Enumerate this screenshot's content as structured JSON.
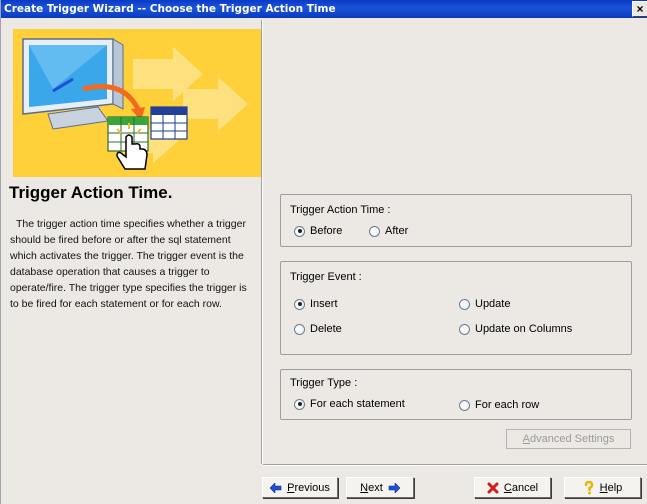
{
  "window": {
    "title": "Create Trigger Wizard -- Choose the Trigger Action Time",
    "close_glyph": "×"
  },
  "left": {
    "heading": "Trigger Action Time.",
    "description": "The trigger action time specifies whether a trigger should be fired before or after the sql statement which activates the trigger. The trigger event is the database operation that causes a trigger to operate/fire. The trigger type specifies the trigger is to be fired for each statement or for each row."
  },
  "action_time": {
    "title": "Trigger Action Time :",
    "options": [
      {
        "label": "Before",
        "checked": true
      },
      {
        "label": "After",
        "checked": false
      }
    ]
  },
  "event": {
    "title": "Trigger Event :",
    "options": [
      {
        "label": "Insert",
        "checked": true
      },
      {
        "label": "Update",
        "checked": false
      },
      {
        "label": "Delete",
        "checked": false
      },
      {
        "label": "Update on Columns",
        "checked": false
      }
    ]
  },
  "type": {
    "title": "Trigger Type :",
    "options": [
      {
        "label": "For each statement",
        "checked": true
      },
      {
        "label": "For each row",
        "checked": false
      }
    ]
  },
  "buttons": {
    "advanced_a": "A",
    "advanced_rest": "dvanced Settings",
    "previous_ul": "P",
    "previous_rest": "revious",
    "next_ul": "N",
    "next_rest": "ext",
    "cancel_ul": "C",
    "cancel_rest": "ancel",
    "help_ul": "H",
    "help_rest": "elp"
  },
  "colors": {
    "title_bar": "#0b39c6",
    "banner_bg": "#fed13b",
    "dialog_bg": "#ece9e4",
    "arrow_blue": "#1f4fd6",
    "cancel_red": "#d41a1a"
  },
  "icons": {
    "previous": "left-arrow-icon",
    "next": "right-arrow-icon",
    "cancel": "red-x-icon",
    "help": "question-mark-icon"
  }
}
